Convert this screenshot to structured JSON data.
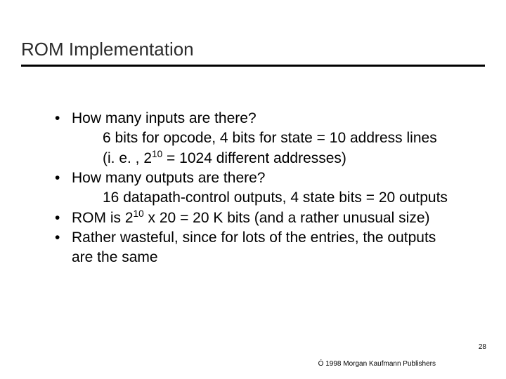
{
  "title": "ROM Implementation",
  "bullets": [
    {
      "main": "How many inputs are there?",
      "sub1": "6 bits for opcode, 4 bits for state = 10 address lines",
      "sub2_pre": "(i. e. , 2",
      "sub2_sup": "10",
      "sub2_post": "  = 1024 different addresses)"
    },
    {
      "main": "How many outputs are there?",
      "sub1": "16 datapath-control outputs, 4 state bits = 20 outputs"
    },
    {
      "main_pre": "ROM is 2",
      "main_sup": "10",
      "main_post": " x 20 = 20 K bits    (and a rather unusual size)"
    },
    {
      "main": "Rather wasteful, since for lots of the entries, the outputs are the same"
    }
  ],
  "page_number": "28",
  "copyright": "Ó 1998 Morgan Kaufmann Publishers"
}
